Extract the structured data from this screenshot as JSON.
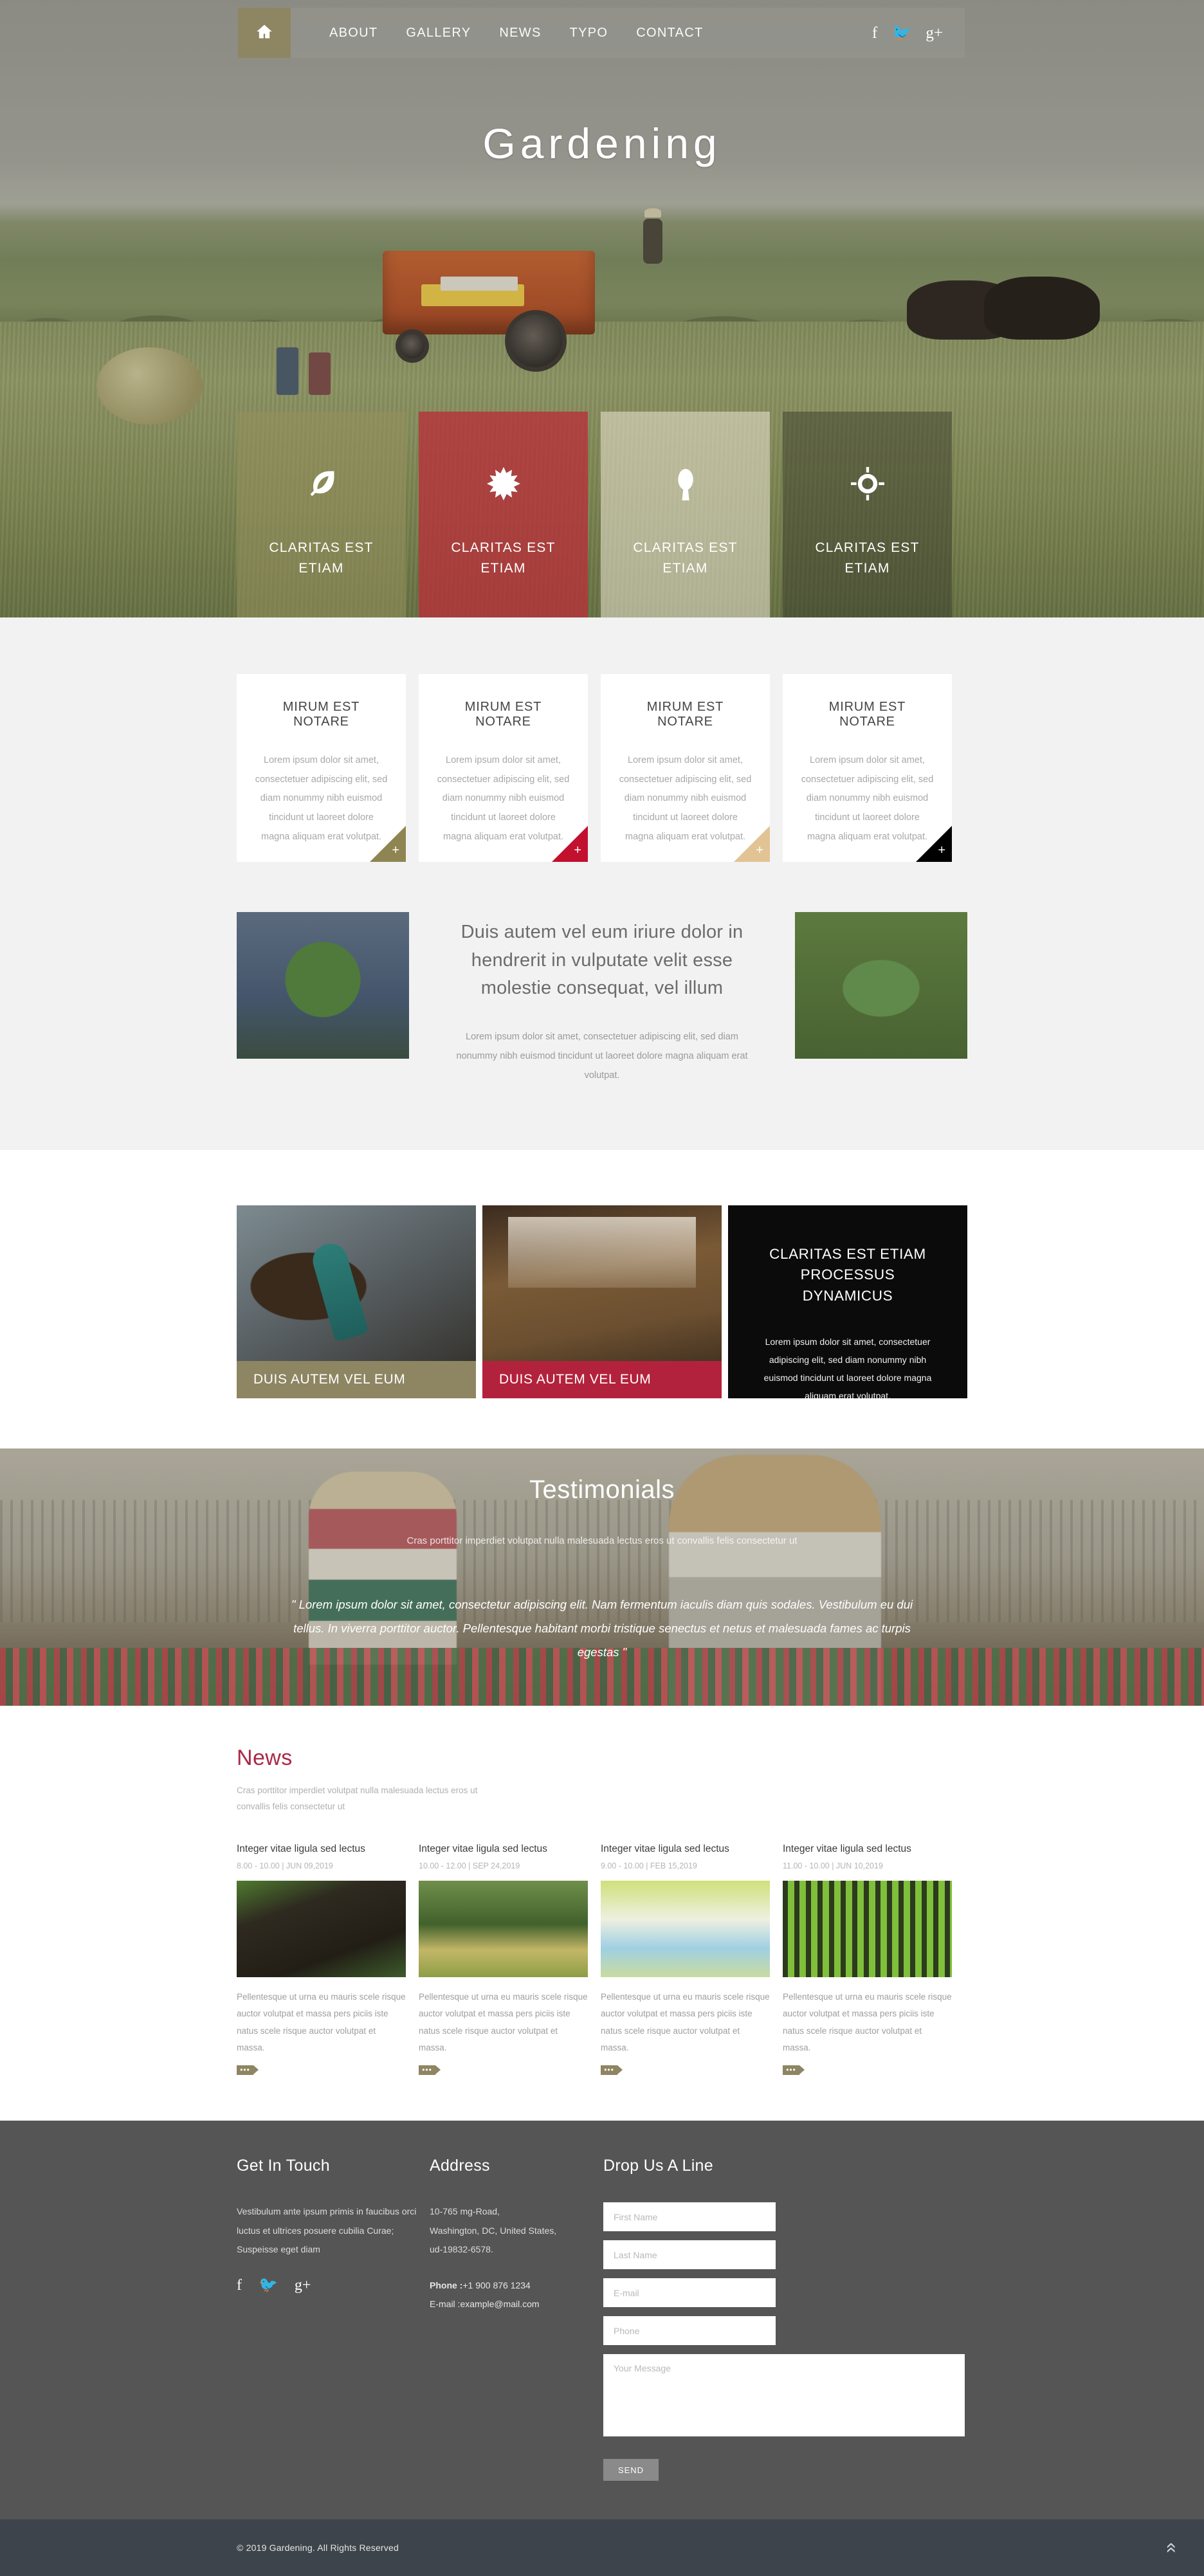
{
  "nav": {
    "home_icon": "home-icon",
    "links": [
      {
        "label": "ABOUT"
      },
      {
        "label": "GALLERY"
      },
      {
        "label": "NEWS"
      },
      {
        "label": "TYPO"
      },
      {
        "label": "CONTACT"
      }
    ],
    "social": [
      {
        "icon": "facebook-icon",
        "glyph": "f"
      },
      {
        "icon": "twitter-icon",
        "glyph": "🐦"
      },
      {
        "icon": "google-plus-icon",
        "glyph": "g+"
      }
    ]
  },
  "hero": {
    "title": "Gardening"
  },
  "features": [
    {
      "icon": "leaf-icon",
      "label": "CLARITAS EST ETIAM",
      "color": "#96905c"
    },
    {
      "icon": "sun-burst-icon",
      "label": "CLARITAS EST ETIAM",
      "color": "#b7303a"
    },
    {
      "icon": "tree-icon",
      "label": "CLARITAS EST ETIAM",
      "color": "#e5e0cd"
    },
    {
      "icon": "compass-icon",
      "label": "CLARITAS EST ETIAM",
      "color": "#343628"
    }
  ],
  "cards": [
    {
      "title": "MIRUM EST NOTARE",
      "body": "Lorem ipsum dolor sit amet, consectetuer adipiscing elit, sed diam nonummy nibh euismod tincidunt ut laoreet dolore magna aliquam erat volutpat.",
      "corner_color": "#8e8553",
      "corner_glyph": "+"
    },
    {
      "title": "MIRUM EST NOTARE",
      "body": "Lorem ipsum dolor sit amet, consectetuer adipiscing elit, sed diam nonummy nibh euismod tincidunt ut laoreet dolore magna aliquam erat volutpat.",
      "corner_color": "#c2102f",
      "corner_glyph": "+"
    },
    {
      "title": "MIRUM EST NOTARE",
      "body": "Lorem ipsum dolor sit amet, consectetuer adipiscing elit, sed diam nonummy nibh euismod tincidunt ut laoreet dolore magna aliquam erat volutpat.",
      "corner_color": "#e2c394",
      "corner_glyph": "+"
    },
    {
      "title": "MIRUM EST NOTARE",
      "body": "Lorem ipsum dolor sit amet, consectetuer adipiscing elit, sed diam nonummy nibh euismod tincidunt ut laoreet dolore magna aliquam erat volutpat.",
      "corner_color": "#000000",
      "corner_glyph": "+"
    }
  ],
  "intro": {
    "left_image_alt": "hands-holding-moss-ball",
    "right_image_alt": "hands-holding-green-leaves",
    "heading": "Duis autem vel eum iriure dolor in hendrerit in vulputate velit esse molestie consequat, vel illum",
    "body": "Lorem ipsum dolor sit amet, consectetuer adipiscing elit, sed diam nonummy nibh euismod tincidunt ut laoreet dolore magna aliquam erat volutpat."
  },
  "promo": {
    "item1": {
      "caption": "DUIS AUTEM VEL EUM",
      "image_alt": "garden-trowel-with-soil",
      "caption_color": "#8e8562"
    },
    "item2": {
      "caption": "DUIS AUTEM VEL EUM",
      "image_alt": "terrarium-workshop-table",
      "caption_color": "#b3223c"
    },
    "item3": {
      "heading": "CLARITAS EST ETIAM PROCESSUS DYNAMICUS",
      "body": "Lorem ipsum dolor sit amet, consectetuer adipiscing elit, sed diam nonummy nibh euismod tincidunt ut laoreet dolore magna aliquam erat volutpat."
    }
  },
  "testimonials": {
    "title": "Testimonials",
    "subtitle": "Cras porttitor imperdiet volutpat nulla malesuada lectus eros ut convallis felis consectetur ut",
    "quote": "\" Lorem ipsum dolor sit amet, consectetur adipiscing elit. Nam fermentum iaculis diam quis sodales. Vestibulum eu dui tellus. In viverra porttitor auctor. Pellentesque habitant morbi tristique senectus et netus et malesuada fames ac turpis egestas \""
  },
  "news": {
    "title": "News",
    "subtitle": "Cras porttitor imperdiet volutpat nulla malesuada lectus eros ut convallis felis consectetur ut",
    "items": [
      {
        "title": "Integer vitae ligula sed lectus",
        "meta": "8.00 - 10.00 | JUN 09,2019",
        "image_alt": "soil-with-green-shoots",
        "body": "Pellentesque ut urna eu mauris scele risque auctor volutpat et massa pers piciis iste natus scele risque auctor volutpat et massa.",
        "more_label": "•••"
      },
      {
        "title": "Integer vitae ligula sed lectus",
        "meta": "10.00 - 12.00 | SEP 24,2019",
        "image_alt": "sheep-in-green-valley",
        "body": "Pellentesque ut urna eu mauris scele risque auctor volutpat et massa pers piciis iste natus scele risque auctor volutpat et massa.",
        "more_label": "•••"
      },
      {
        "title": "Integer vitae ligula sed lectus",
        "meta": "9.00 - 10.00 | FEB 15,2019",
        "image_alt": "white-flowers-in-basket",
        "body": "Pellentesque ut urna eu mauris scele risque auctor volutpat et massa pers piciis iste natus scele risque auctor volutpat et massa.",
        "more_label": "•••"
      },
      {
        "title": "Integer vitae ligula sed lectus",
        "meta": "11.00 - 10.00 | JUN 10,2019",
        "image_alt": "sunlit-forest-trees",
        "body": "Pellentesque ut urna eu mauris scele risque auctor volutpat et massa pers piciis iste natus scele risque auctor volutpat et massa.",
        "more_label": "•••"
      }
    ]
  },
  "footer": {
    "touch": {
      "title": "Get In Touch",
      "body": "Vestibulum ante ipsum primis in faucibus orci luctus et ultrices posuere cubilia Curae; Suspeisse eget diam",
      "social": [
        {
          "icon": "facebook-icon",
          "glyph": "f"
        },
        {
          "icon": "twitter-icon",
          "glyph": "🐦"
        },
        {
          "icon": "google-plus-icon",
          "glyph": "g+"
        }
      ]
    },
    "address": {
      "title": "Address",
      "line1": "10-765 mg-Road,",
      "line2": "Washington, DC, United States,",
      "line3": "ud-19832-6578.",
      "phone_label": "Phone :",
      "phone_value": "+1 900 876 1234",
      "email_label": "E-mail :",
      "email_value": "example@mail.com"
    },
    "form": {
      "title": "Drop Us A Line",
      "first_name_placeholder": "First Name",
      "last_name_placeholder": "Last Name",
      "email_placeholder": "E-mail",
      "phone_placeholder": "Phone",
      "message_placeholder": "Your Message",
      "first_name_value": "",
      "last_name_value": "",
      "email_value": "",
      "phone_value": "",
      "message_value": "",
      "send_label": "SEND"
    }
  },
  "bottombar": {
    "copyright": "© 2019 Gardening. All Rights Reserved",
    "to_top_icon": "chevron-up-icon",
    "to_top_glyph": "»"
  }
}
